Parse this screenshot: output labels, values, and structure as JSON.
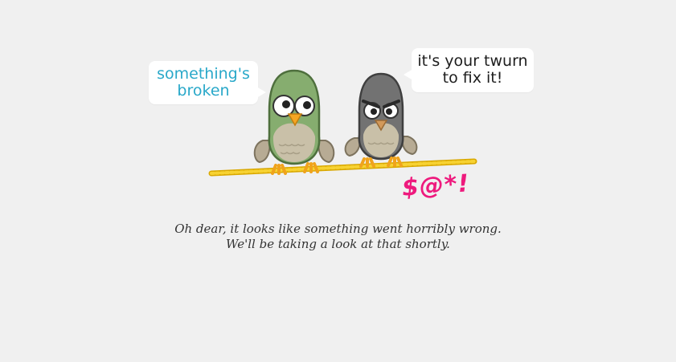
{
  "bubbles": {
    "left": {
      "line1": "something's",
      "line2": "broken"
    },
    "right": {
      "line1": "it's your twurn",
      "line2": "to fix it!"
    }
  },
  "curse_text": "$@*!",
  "message": {
    "line1": "Oh dear, it looks like something went horribly wrong.",
    "line2": "We'll be taking a look at that shortly."
  },
  "colors": {
    "background": "#f0f0f0",
    "bubble_left_text": "#29a8c9",
    "curse": "#ee1a7d",
    "rope": "#f2c200",
    "green_bird": "#7fa86a",
    "grey_bird": "#6e6e6e"
  },
  "icons": {
    "illustration": "two-birds-on-rope-illustration"
  }
}
